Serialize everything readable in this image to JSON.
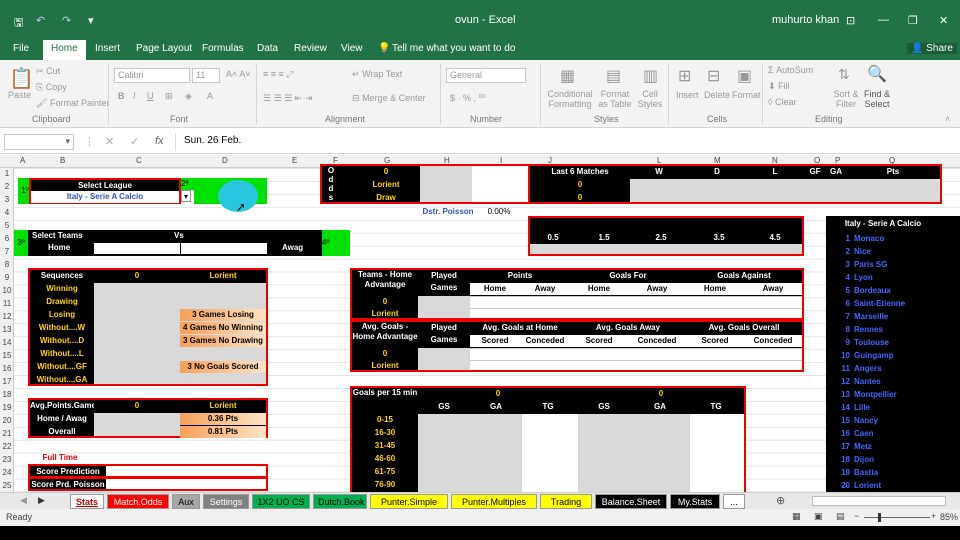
{
  "window": {
    "app_title": "ovun - Excel",
    "user": "muhurto khan",
    "share": "Share",
    "tell_me": "Tell me what you want to do"
  },
  "ribbon_tabs": [
    "File",
    "Home",
    "Insert",
    "Page Layout",
    "Formulas",
    "Data",
    "Review",
    "View"
  ],
  "ribbon": {
    "clipboard": {
      "label": "Clipboard",
      "paste": "Paste",
      "cut": "Cut",
      "copy": "Copy",
      "format_painter": "Format Painter"
    },
    "font": {
      "label": "Font",
      "family": "Calibri",
      "size": "11"
    },
    "alignment": {
      "label": "Alignment",
      "wrap": "Wrap Text",
      "merge": "Merge & Center"
    },
    "number": {
      "label": "Number",
      "format": "General"
    },
    "styles": {
      "label": "Styles",
      "cond": "Conditional Formatting",
      "fmt_table": "Format as Table",
      "cell_styles": "Cell Styles"
    },
    "cells": {
      "label": "Cells",
      "insert": "Insert",
      "delete": "Delete",
      "format": "Format"
    },
    "editing": {
      "label": "Editing",
      "autosum": "AutoSum",
      "fill": "Fill",
      "clear": "Clear",
      "sort": "Sort & Filter",
      "find": "Find & Select"
    }
  },
  "formula_bar": {
    "fx": "fx",
    "value": "Sun. 26 Feb."
  },
  "columns": [
    "A",
    "B",
    "C",
    "D",
    "E",
    "F",
    "G",
    "H",
    "I",
    "J",
    "L",
    "M",
    "N",
    "O",
    "P",
    "Q"
  ],
  "rows": [
    "1",
    "2",
    "3",
    "4",
    "5",
    "6",
    "7",
    "8",
    "9",
    "10",
    "11",
    "12",
    "13",
    "14",
    "15",
    "16",
    "17",
    "18",
    "19",
    "20",
    "21",
    "22",
    "23",
    "24",
    "25"
  ],
  "sheet": {
    "select_league": "Select League",
    "league_value": "Italy - Serie A Calcio",
    "badge_1": "1º",
    "badge_2": "2º",
    "select_teams": "Select Teams",
    "vs": "Vs",
    "home": "Home",
    "away": "Awag",
    "badge_3": "3º",
    "badge_4": "4º",
    "odds_col": [
      "O",
      "d",
      "d",
      "s"
    ],
    "odds_head": "0",
    "odds_lorient": "Lorient",
    "odds_draw": "Draw",
    "last6": "Last 6 Matches",
    "last6_v1": "0",
    "last6_v2": "0",
    "w": "W",
    "d": "D",
    "l": "L",
    "gf": "GF",
    "ga": "GA",
    "pts": "Pts",
    "poisson_lbl": "Dstr. Poisson",
    "poisson_val": "0.00%",
    "ou": [
      "0.5",
      "1.5",
      "2.5",
      "3.5",
      "4.5"
    ],
    "seq_head": "Sequences",
    "seq_v": "0",
    "seq_team": "Lorient",
    "seq_rows": [
      "Winning",
      "Drawing",
      "Losing",
      "Without....W",
      "Without....D",
      "Without....L",
      "Without....GF",
      "Without....GA"
    ],
    "seq_vals": [
      "3 Games Losing",
      "4 Games No Winning",
      "3 Games No Drawing",
      "3 No Goals Scored"
    ],
    "teams_head": "Teams - Home Advantage",
    "played": "Played Games",
    "points": "Points",
    "goals_for": "Goals For",
    "goals_against": "Goals Against",
    "home_lbl": "Home",
    "away_lbl": "Away",
    "zero": "0",
    "lorient": "Lorient",
    "avg_head": "Avg. Goals - Home Advantage",
    "avg_home": "Avg. Goals at Home",
    "avg_away": "Avg. Goals Away",
    "avg_overall": "Avg. Goals Overall",
    "scored": "Scored",
    "conceded": "Conceded",
    "apg_head": "Avg.Points.Game",
    "apg_v": "0",
    "apg_team": "Lorient",
    "home_away": "Home / Awag",
    "overall": "Overall",
    "pts_1": "0.36 Pts",
    "pts_2": "0.81 Pts",
    "full_time": "Full Time",
    "score_pred": "Score Prediction",
    "score_poisson": "Score Prd. Poisson",
    "gp15": "Goals per 15 min",
    "gs": "GS",
    "tg": "TG",
    "intervals": [
      "0-15",
      "16-30",
      "31-45",
      "46-60",
      "61-75",
      "76-90"
    ],
    "league_list_head": "Italy - Serie A Calcio",
    "teams_list": [
      "Monaco",
      "Nice",
      "Paris SG",
      "Lyon",
      "Bordeaux",
      "Saint-Etienne",
      "Marseille",
      "Rennes",
      "Toulouse",
      "Guingamp",
      "Angers",
      "Nantes",
      "Montpellier",
      "Lille",
      "Nancy",
      "Caen",
      "Metz",
      "Dijon",
      "Bastia",
      "Lorient"
    ]
  },
  "sheet_tabs": [
    {
      "label": "Stats",
      "bg": "#ffffff",
      "fg": "#c00000"
    },
    {
      "label": "Match.Odds",
      "bg": "#ff0000",
      "fg": "#ffffff"
    },
    {
      "label": "Aux",
      "bg": "#a6a6a6",
      "fg": "#000000"
    },
    {
      "label": "Settings",
      "bg": "#808080",
      "fg": "#ffffff"
    },
    {
      "label": "1X2 UO CS",
      "bg": "#00b050",
      "fg": "#000000"
    },
    {
      "label": "Dutch.Book",
      "bg": "#00b050",
      "fg": "#000000"
    },
    {
      "label": "Punter.Simple",
      "bg": "#ffff00",
      "fg": "#000000"
    },
    {
      "label": "Punter.Multiples",
      "bg": "#ffff00",
      "fg": "#000000"
    },
    {
      "label": "Trading",
      "bg": "#ffff00",
      "fg": "#000000"
    },
    {
      "label": "Balance.Sheet",
      "bg": "#000000",
      "fg": "#ffffff"
    },
    {
      "label": "My.Stats",
      "bg": "#000000",
      "fg": "#ffffff"
    },
    {
      "label": "...",
      "bg": "#ffffff",
      "fg": "#000000"
    }
  ],
  "status": {
    "ready": "Ready",
    "zoom": "85%"
  }
}
